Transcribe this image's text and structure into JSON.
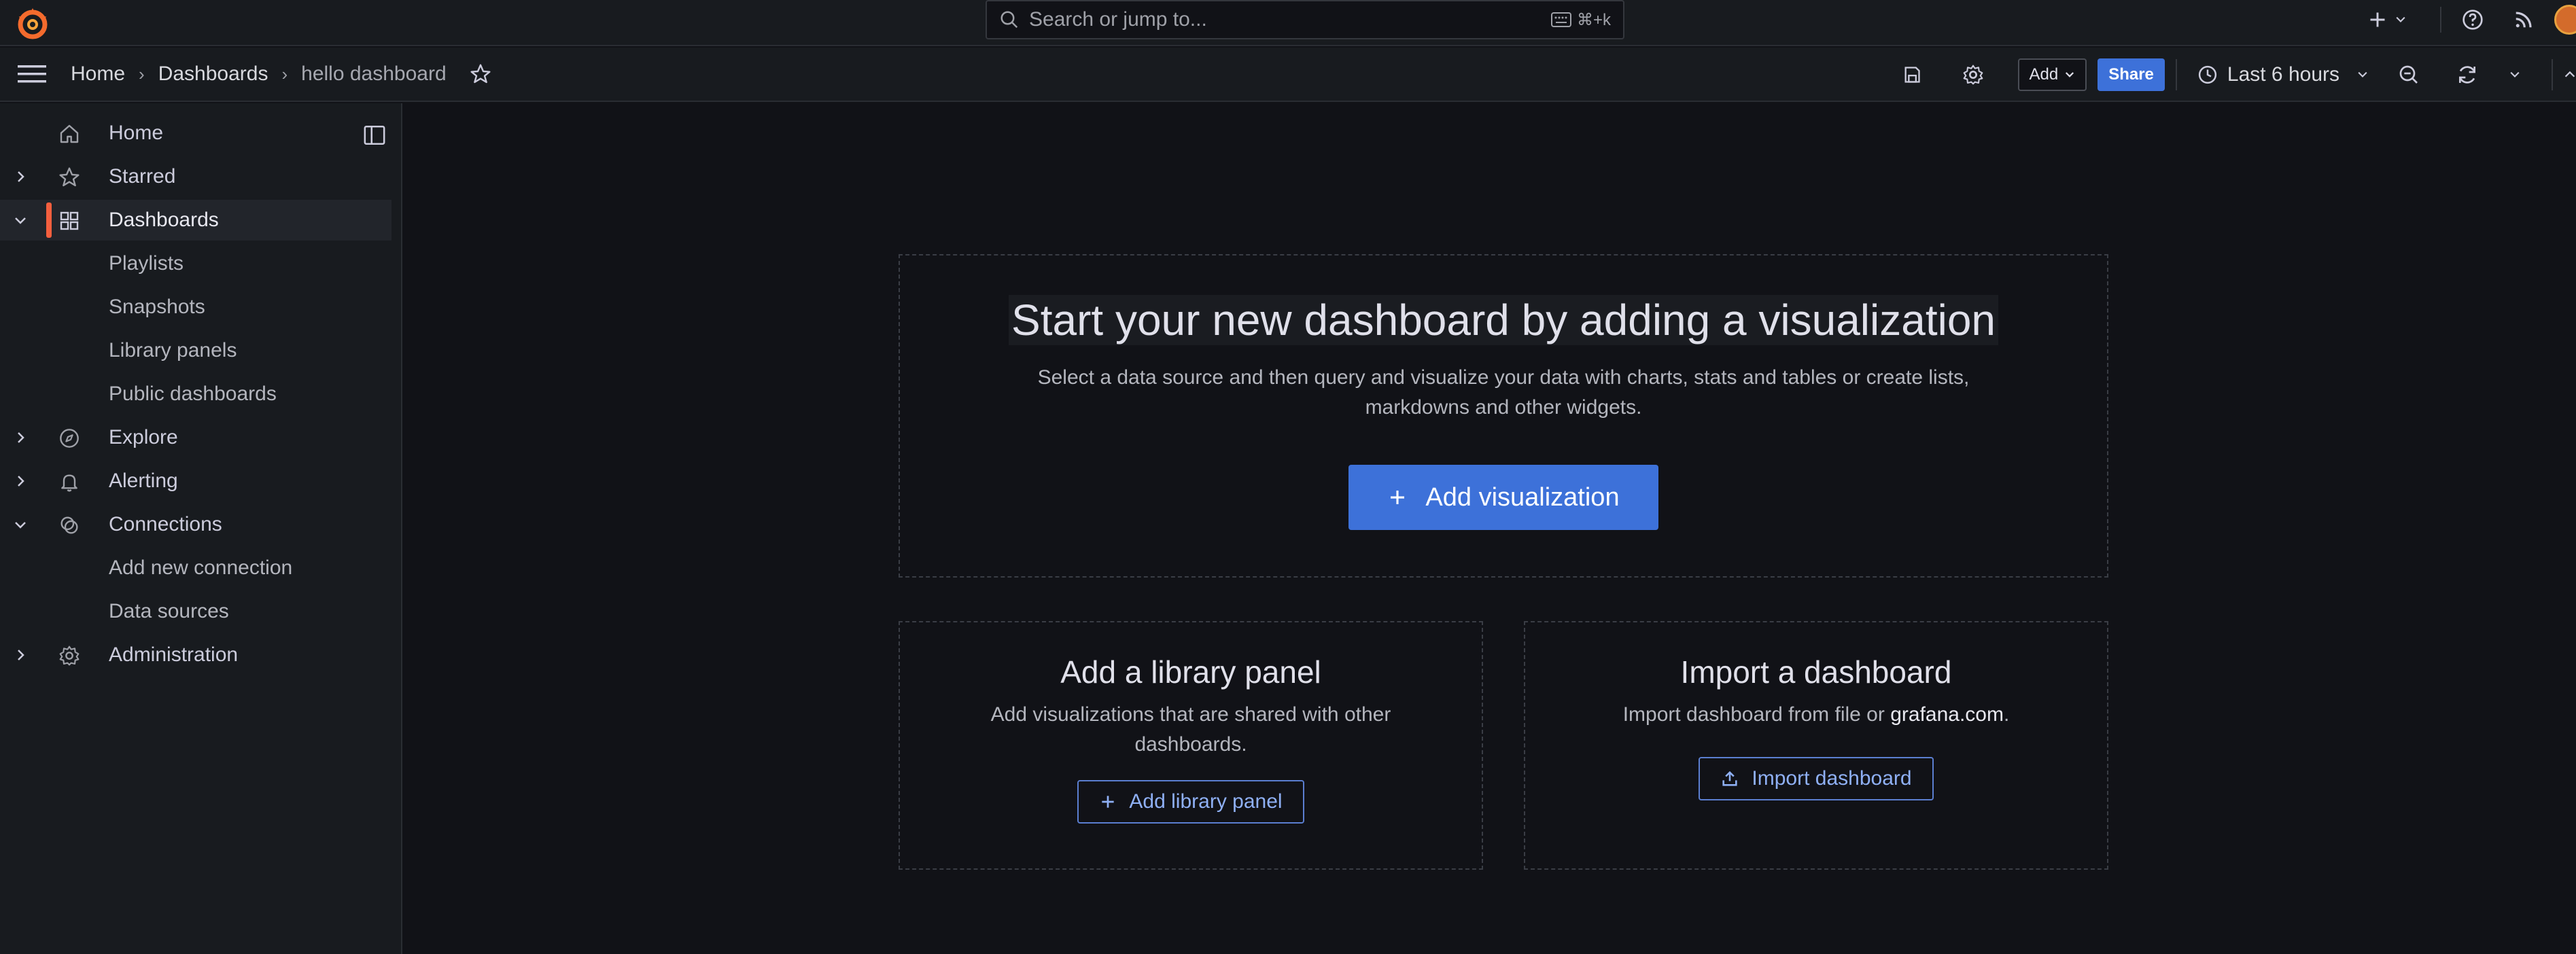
{
  "colors": {
    "background": "#111217",
    "panel": "#181b1f",
    "primary": "#3d71d9",
    "accent": "#f55f3e"
  },
  "topbar": {
    "search_placeholder": "Search or jump to...",
    "search_shortcut": "⌘+k",
    "icons": [
      "grafana-logo-icon",
      "search-icon",
      "keyboard-icon",
      "plus-icon",
      "chevron-down-icon",
      "help-icon",
      "rss-icon",
      "avatar"
    ]
  },
  "breadcrumb": {
    "items": [
      "Home",
      "Dashboards",
      "hello dashboard"
    ]
  },
  "toolbar": {
    "add_label": "Add",
    "share_label": "Share",
    "time_range": "Last 6 hours"
  },
  "sidebar": {
    "items": [
      {
        "label": "Home",
        "icon": "home-icon"
      },
      {
        "label": "Starred",
        "icon": "star-icon"
      },
      {
        "label": "Dashboards",
        "icon": "grid-icon",
        "active": true
      },
      {
        "label": "Playlists"
      },
      {
        "label": "Snapshots"
      },
      {
        "label": "Library panels"
      },
      {
        "label": "Public dashboards"
      },
      {
        "label": "Explore",
        "icon": "compass-icon"
      },
      {
        "label": "Alerting",
        "icon": "bell-icon"
      },
      {
        "label": "Connections",
        "icon": "connections-icon"
      },
      {
        "label": "Add new connection"
      },
      {
        "label": "Data sources"
      },
      {
        "label": "Administration",
        "icon": "cog-icon"
      }
    ]
  },
  "main": {
    "hero": {
      "title": "Start your new dashboard by adding a visualization",
      "description": "Select a data source and then query and visualize your data with charts, stats and tables or create lists, markdowns and other widgets.",
      "button": "Add visualization"
    },
    "library": {
      "title": "Add a library panel",
      "description": "Add visualizations that are shared with other dashboards.",
      "button": "Add library panel"
    },
    "import": {
      "title": "Import a dashboard",
      "description_prefix": "Import dashboard from file or ",
      "description_link": "grafana.com",
      "description_suffix": ".",
      "button": "Import dashboard"
    }
  }
}
